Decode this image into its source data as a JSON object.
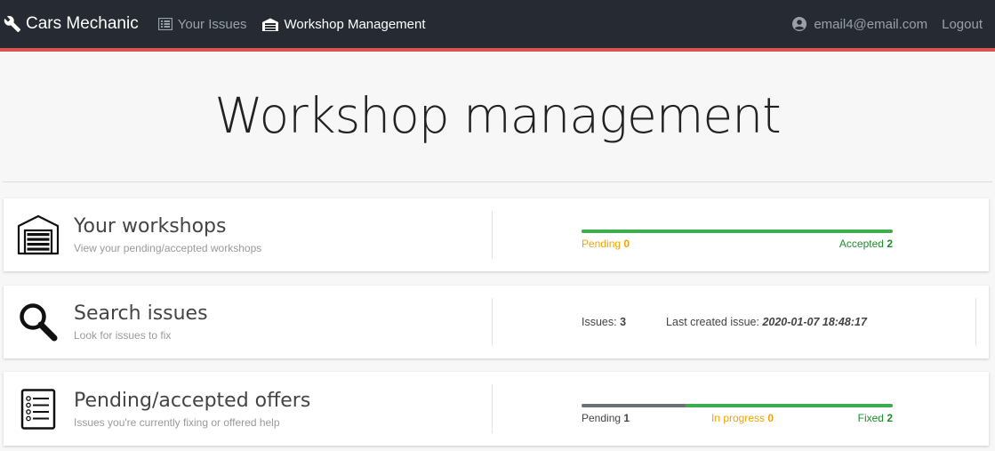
{
  "nav": {
    "brand": "Cars Mechanic",
    "your_issues": "Your Issues",
    "workshop_management": "Workshop Management",
    "user_email": "email4@email.com",
    "logout": "Logout"
  },
  "page": {
    "title": "Workshop management"
  },
  "cards": {
    "workshops": {
      "title": "Your workshops",
      "subtitle": "View your pending/accepted workshops",
      "pending_label": "Pending",
      "pending_count": "0",
      "accepted_label": "Accepted",
      "accepted_count": "2"
    },
    "search": {
      "title": "Search issues",
      "subtitle": "Look for issues to fix",
      "issues_label": "Issues:",
      "issues_count": "3",
      "last_label": "Last created issue:",
      "last_value": "2020-01-07 18:48:17"
    },
    "offers": {
      "title": "Pending/accepted offers",
      "subtitle": "Issues you're currently fixing or offered help",
      "pending_label": "Pending",
      "pending_count": "1",
      "inprogress_label": "In progress",
      "inprogress_count": "0",
      "fixed_label": "Fixed",
      "fixed_count": "2"
    }
  },
  "progress": {
    "workshops": {
      "pending": 0,
      "accepted": 2
    },
    "offers": {
      "pending": 1,
      "in_progress": 0,
      "fixed": 2
    }
  },
  "colors": {
    "navbar_bg": "#262b33",
    "accent_red": "#d9534f",
    "green": "#1e8c2e",
    "bar_green": "#3cae4e",
    "orange": "#f0a30a",
    "gray_bar": "#6c6f75"
  },
  "icons": {
    "brand": "wrench-icon",
    "your_issues": "list-icon",
    "workshop": "garage-icon",
    "user": "user-circle-icon",
    "card_workshops": "garage-icon",
    "card_search": "search-icon",
    "card_offers": "checklist-icon"
  }
}
